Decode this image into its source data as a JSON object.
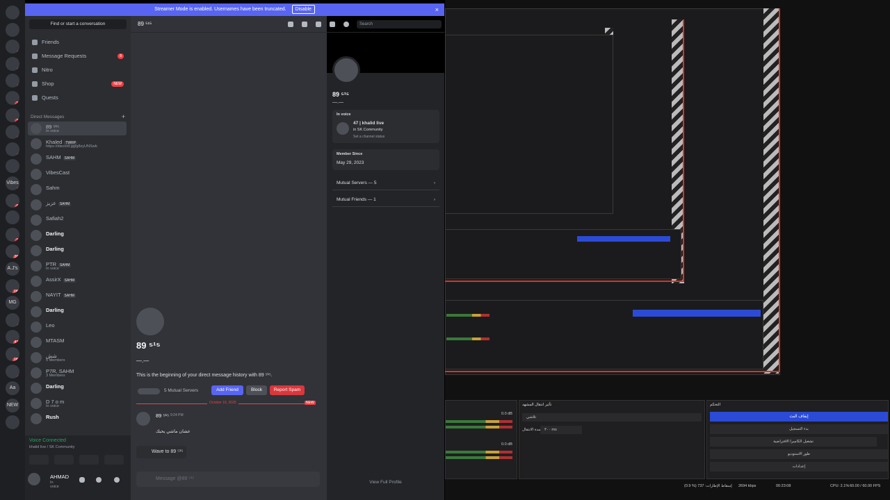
{
  "banner": {
    "text": "Streamer Mode is enabled. Usernames have been truncated.",
    "disable": "Disable",
    "close": "×"
  },
  "rail": {
    "servers": [
      {
        "label": "",
        "badge": ""
      },
      {
        "label": "",
        "badge": ""
      },
      {
        "label": "",
        "badge": "1"
      },
      {
        "label": "",
        "badge": "1"
      },
      {
        "label": "",
        "badge": "8"
      },
      {
        "label": "",
        "badge": "10"
      },
      {
        "label": "",
        "badge": "20"
      },
      {
        "label": "",
        "badge": "4"
      },
      {
        "label": "",
        "badge": "1"
      },
      {
        "label": "",
        "badge": ""
      },
      {
        "label": "Vibes",
        "badge": "1"
      },
      {
        "label": "",
        "badge": "99"
      },
      {
        "label": "",
        "badge": ""
      },
      {
        "label": "",
        "badge": "19"
      },
      {
        "label": "",
        "badge": "264"
      },
      {
        "label": "A.J's",
        "badge": ""
      },
      {
        "label": "",
        "badge": "1K+"
      },
      {
        "label": "MG",
        "badge": ""
      },
      {
        "label": "",
        "badge": "1"
      },
      {
        "label": "",
        "badge": "479"
      },
      {
        "label": "",
        "badge": "1K+"
      },
      {
        "label": "",
        "badge": "2"
      },
      {
        "label": "Aa",
        "badge": ""
      },
      {
        "label": "NEW",
        "badge": ""
      },
      {
        "label": "",
        "badge": ""
      }
    ]
  },
  "sidebar": {
    "find": "Find or start a conversation",
    "nav": [
      {
        "label": "Friends",
        "pill": ""
      },
      {
        "label": "Message Requests",
        "pill": "8"
      },
      {
        "label": "Nitro",
        "pill": ""
      },
      {
        "label": "Shop",
        "pill": "NEW"
      },
      {
        "label": "Quests",
        "pill": ""
      }
    ],
    "dm_header": "Direct Messages",
    "dm_plus": "+",
    "dms": [
      {
        "name": "89 ⁵¹⁵",
        "tag": "",
        "sub": "In voice"
      },
      {
        "name": "Khaled",
        "tag": "TWRP",
        "sub": "https://discord.gg/g8zyUNSwb"
      },
      {
        "name": "SAHM",
        "tag": "SAHM",
        "sub": ""
      },
      {
        "name": "VibesCast",
        "tag": "",
        "sub": ""
      },
      {
        "name": "Sahm",
        "tag": "",
        "sub": ""
      },
      {
        "name": "عزيز",
        "tag": "SAHM",
        "sub": ""
      },
      {
        "name": "Safiah2",
        "tag": "",
        "sub": ""
      },
      {
        "name": "Darling",
        "tag": "",
        "sub": ""
      },
      {
        "name": "Darling",
        "tag": "",
        "sub": ""
      },
      {
        "name": "PTR",
        "tag": "SAHM",
        "sub": "In voice"
      },
      {
        "name": "AssirX",
        "tag": "SAHM",
        "sub": ""
      },
      {
        "name": "NAYIT",
        "tag": "SAHM",
        "sub": ""
      },
      {
        "name": "Darling",
        "tag": "",
        "sub": ""
      },
      {
        "name": "Leo",
        "tag": "",
        "sub": ""
      },
      {
        "name": "MTASM",
        "tag": "",
        "sub": ""
      },
      {
        "name": "شش",
        "tag": "",
        "sub": "5 Members"
      },
      {
        "name": "P7R, SAHM",
        "tag": "",
        "sub": "3 Members"
      },
      {
        "name": "Darling",
        "tag": "",
        "sub": ""
      },
      {
        "name": "D 7 o m",
        "tag": "",
        "sub": "In voice"
      },
      {
        "name": "Rush",
        "tag": "",
        "sub": ""
      }
    ]
  },
  "voice": {
    "status": "Voice Connected",
    "channel": "khalid live / SK Community"
  },
  "user": {
    "name": "AHMAD",
    "status": "In voice"
  },
  "chat": {
    "header_name": "89 ⁵¹⁵",
    "search": "Search",
    "intro_name": "89 ⁵¹⁵",
    "intro_dash": "—.—",
    "intro_text": "This is the beginning of your direct message history with 89 ⁵¹⁵.",
    "mutual": "5 Mutual Servers",
    "add_friend": "Add Friend",
    "block": "Block",
    "report": "Report Spam",
    "date": "October 16, 2025",
    "new": "NEW",
    "msg_author": "89 ⁵¹⁵",
    "msg_time": "9:24 PM",
    "msg_text": "عشان ماشي يحبك",
    "wave": "Wave to 89 ⁵¹⁵",
    "composer": "Message @89 ⁵¹⁵",
    "colors": {
      "blurple": "#5865f2",
      "red": "#da373c",
      "grey": "#4e5058"
    }
  },
  "profile": {
    "name": "89 ⁵¹⁵",
    "dash": "—.—",
    "in_voice": "In voice",
    "voice_title": "47 | khalid live",
    "voice_server": "in SK Community",
    "voice_status": "Set a channel status",
    "member_since_label": "Member Since",
    "member_since": "May 29, 2023",
    "mutual_servers": "Mutual Servers — 5",
    "mutual_friends": "Mutual Friends — 1",
    "view_full": "View Full Profile"
  },
  "obs": {
    "dock1": "تأثير انتقال المشهد",
    "dock2": "التحكم",
    "duration_label": "مدة الانتقال",
    "duration_val": "٣٠٠ ms",
    "transition": "تلاشي",
    "btn_stop": "إيقاف البث",
    "btn_record": "بدء التسجيل",
    "btn_vcam": "تشغيل الكاميرا الافتراضية",
    "btn_studio": "طور الاستوديو",
    "btn_settings": "إعدادات",
    "db1": "0.0 dB",
    "db2": "0.0 dB",
    "status_fps": "60.00 / 60.00 FPS",
    "status_cpu": "CPU: 2.1%",
    "status_time": "00:23:08",
    "status_kbps": "2694 kbps",
    "status_dropped": "(0.9 %) 737 :إسقاط الإطارات"
  }
}
